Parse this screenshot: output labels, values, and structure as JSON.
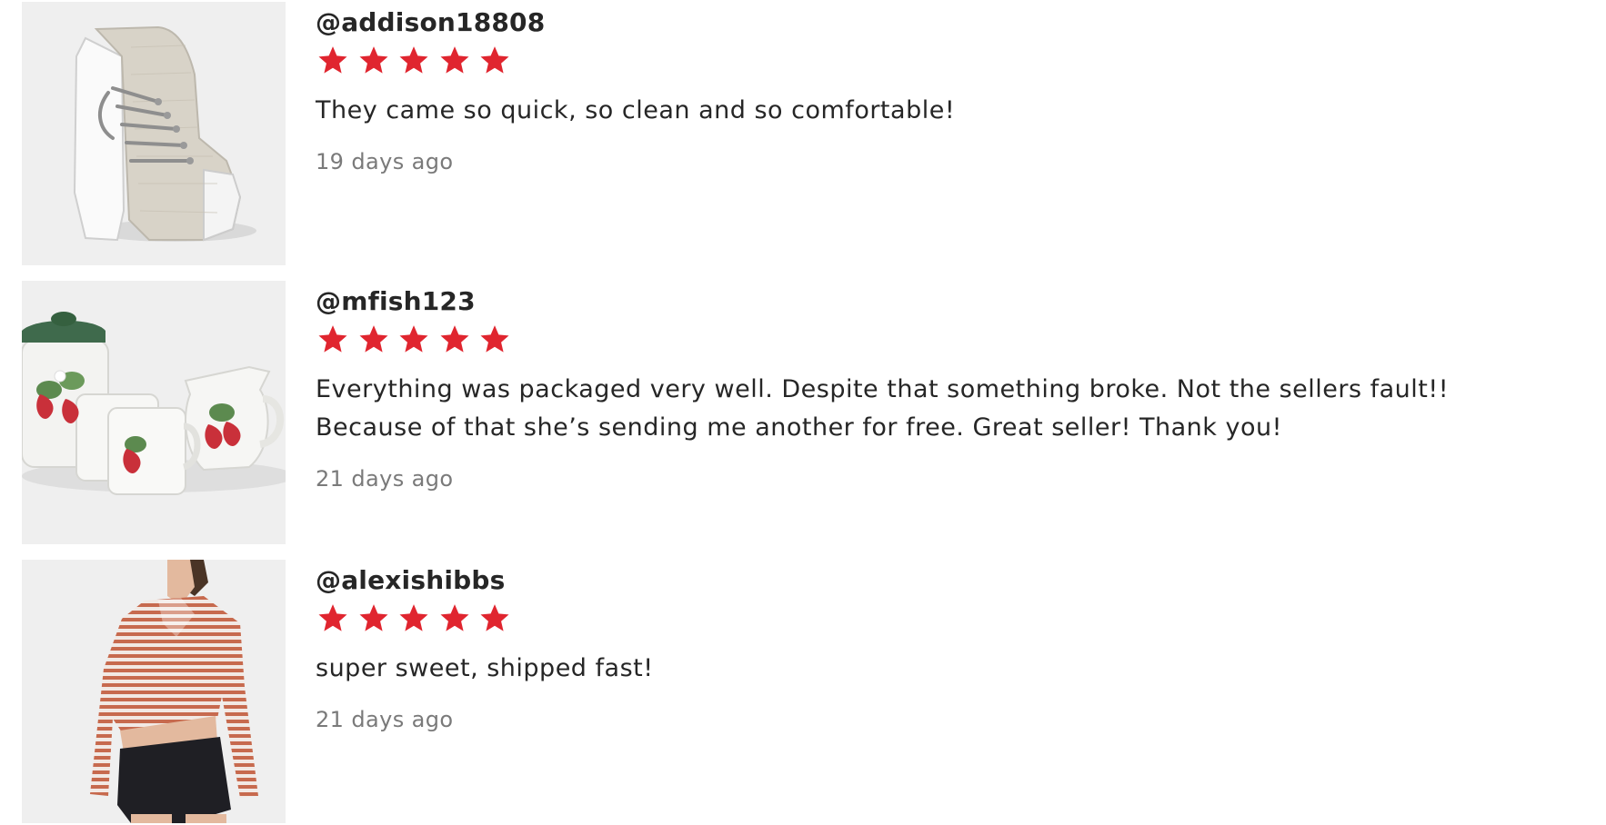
{
  "colors": {
    "star": "#e0252f",
    "text": "#262626",
    "muted": "#7a7a7a"
  },
  "reviews": [
    {
      "username": "@addison18808",
      "rating": 5,
      "text_lines": [
        "They came so quick, so clean and so comfortable!"
      ],
      "date": "19 days ago",
      "thumbnail_icon": "sneaker-photo"
    },
    {
      "username": "@mfish123",
      "rating": 5,
      "text_lines": [
        "Everything was packaged very well. Despite that something broke. Not the sellers fault!!",
        "Because of that she’s sending me another for free. Great seller! Thank you!"
      ],
      "date": "21 days ago",
      "thumbnail_icon": "strawberry-ceramics-photo"
    },
    {
      "username": "@alexishibbs",
      "rating": 5,
      "text_lines": [
        "super sweet, shipped fast!"
      ],
      "date": "21 days ago",
      "thumbnail_icon": "striped-top-photo"
    }
  ]
}
